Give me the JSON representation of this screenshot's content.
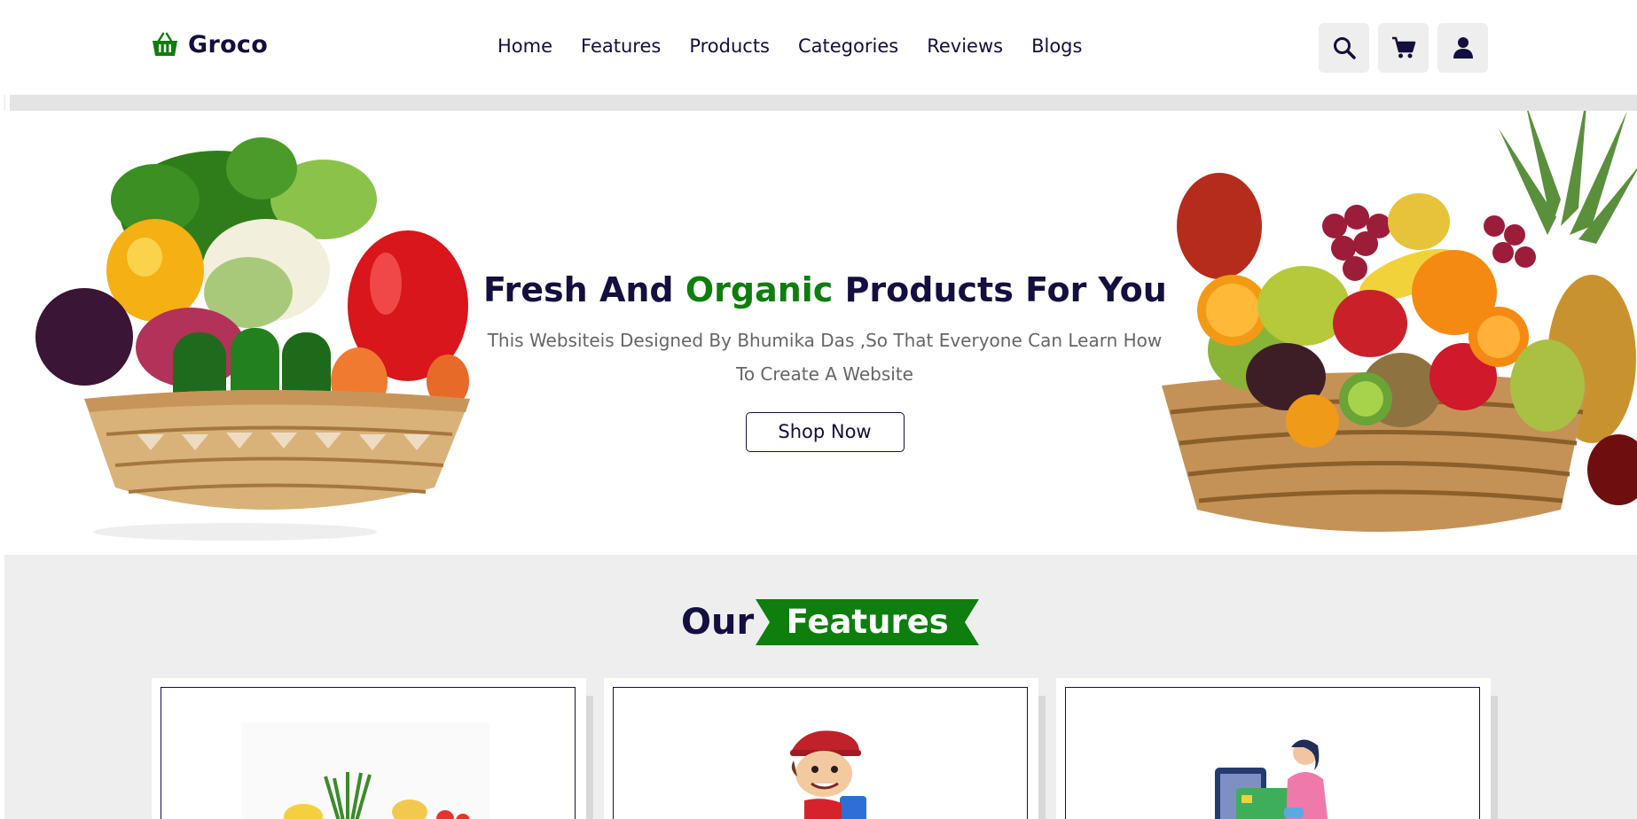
{
  "brand": {
    "name": "Groco",
    "logo_icon": "basket-icon",
    "accent_color": "#0e7e0e",
    "text_color": "#130f40"
  },
  "nav": {
    "items": [
      {
        "label": "Home"
      },
      {
        "label": "Features"
      },
      {
        "label": "Products"
      },
      {
        "label": "Categories"
      },
      {
        "label": "Reviews"
      },
      {
        "label": "Blogs"
      }
    ]
  },
  "header_icons": [
    "search-icon",
    "cart-icon",
    "user-icon"
  ],
  "hero": {
    "title_part1": "Fresh And ",
    "title_accent": "Organic",
    "title_part2": " Products For You",
    "description": "This Websiteis Designed By Bhumika Das ,So That Everyone Can Learn How To Create A Website",
    "button_label": "Shop Now"
  },
  "features": {
    "heading_prefix": "Our",
    "heading_highlight": "Features",
    "cards": [
      {
        "image": "fresh-produce-image"
      },
      {
        "image": "delivery-boy-image"
      },
      {
        "image": "online-payment-image"
      }
    ]
  }
}
